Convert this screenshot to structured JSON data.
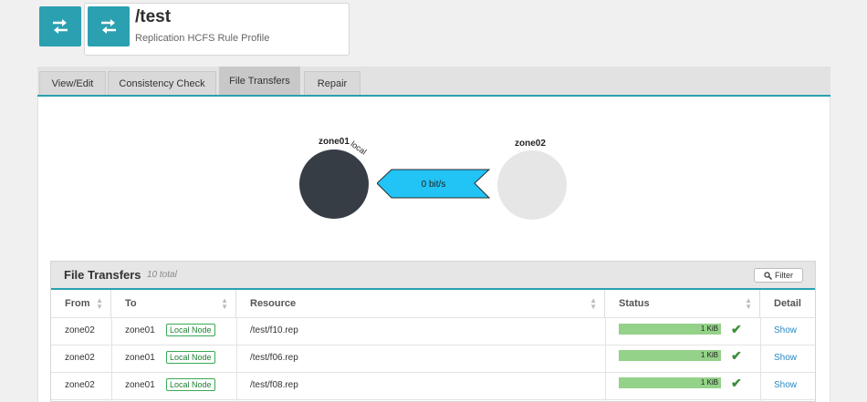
{
  "header": {
    "title": "/test",
    "subtitle": "Replication HCFS Rule Profile",
    "left_icon": "swap-arrows-icon",
    "title_icon": "swap-arrows-icon",
    "accent": "#2aa0b1"
  },
  "tabs": [
    {
      "label": "View/Edit",
      "active": false
    },
    {
      "label": "Consistency Check",
      "active": false
    },
    {
      "label": "File Transfers",
      "active": true
    },
    {
      "label": "Repair",
      "active": false
    }
  ],
  "diagram": {
    "local_zone": "zone01",
    "local_tag": "local",
    "remote_zone": "zone02",
    "rate": "0 bit/s",
    "local_color": "#373d45",
    "remote_color": "#e6e6e6",
    "arrow_color": "#22c3f5"
  },
  "panel": {
    "title": "File Transfers",
    "count": "10 total",
    "filter_label": "Filter"
  },
  "table": {
    "columns": [
      "From",
      "To",
      "Resource",
      "Status",
      "Detail"
    ],
    "badge_label": "Local Node",
    "rows": [
      {
        "from": "zone02",
        "to": "zone01",
        "resource": "/test/f10.rep",
        "status": "1 KiB",
        "detail": "Show"
      },
      {
        "from": "zone02",
        "to": "zone01",
        "resource": "/test/f06.rep",
        "status": "1 KiB",
        "detail": "Show"
      },
      {
        "from": "zone02",
        "to": "zone01",
        "resource": "/test/f08.rep",
        "status": "1 KiB",
        "detail": "Show"
      }
    ]
  }
}
